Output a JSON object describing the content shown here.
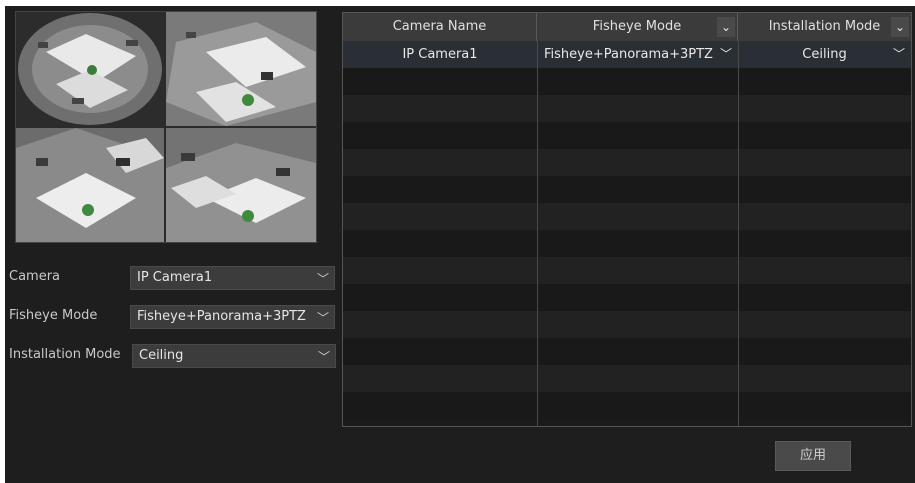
{
  "preview": {
    "views": [
      "fisheye-view",
      "ptz-view-1",
      "ptz-view-2",
      "ptz-view-3"
    ]
  },
  "form": {
    "camera": {
      "label": "Camera",
      "value": "IP Camera1"
    },
    "fisheye_mode": {
      "label": "Fisheye Mode",
      "value": "Fisheye+Panorama+3PTZ"
    },
    "installation_mode": {
      "label": "Installation Mode",
      "value": "Ceiling"
    }
  },
  "table": {
    "columns": [
      "Camera Name",
      "Fisheye Mode",
      "Installation Mode"
    ],
    "rows": [
      {
        "camera_name": "IP Camera1",
        "fisheye_mode": "Fisheye+Panorama+3PTZ",
        "installation_mode": "Ceiling"
      }
    ]
  },
  "apply_label": "应用",
  "icons": {
    "dropdown": "chevron-down-icon"
  }
}
